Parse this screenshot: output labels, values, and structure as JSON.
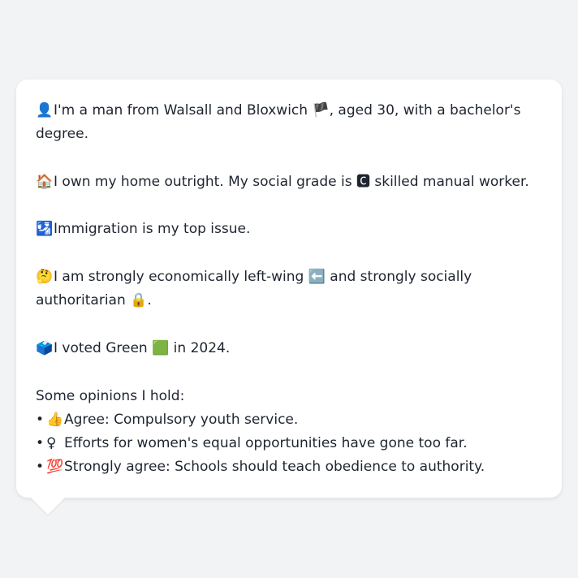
{
  "profile": {
    "p1": {
      "icon": "👤",
      "text_before": "I'm a man from Walsall and Bloxwich ",
      "flag": "🏴",
      "text_after": ", aged 30, with a bachelor's degree."
    },
    "p2": {
      "icon": "🏠",
      "text_before": "I own my home outright. My social grade is ",
      "grade_icon": "🅲",
      "text_after": " skilled manual worker."
    },
    "p3": {
      "icon": "🛂",
      "text": "Immigration is my top issue."
    },
    "p4": {
      "icon": "🤔",
      "text_before": "I am strongly economically left-wing ",
      "left_icon": "⬅️",
      "text_mid": " and strongly socially authoritarian ",
      "lock_icon": "🔒",
      "text_after": "."
    },
    "p5": {
      "icon": "🗳️",
      "text_before": "I voted Green ",
      "party_icon": "🟩",
      "text_after": " in 2024."
    }
  },
  "opinions": {
    "heading": "Some opinions I hold:",
    "bullet": "•",
    "items": [
      {
        "icon": "👍",
        "text": "Agree: Compulsory youth service."
      },
      {
        "icon": "♀",
        "text": "Efforts for women's equal opportunities have gone too far."
      },
      {
        "icon": "💯",
        "text": "Strongly agree: Schools should teach obedience to authority."
      }
    ]
  }
}
